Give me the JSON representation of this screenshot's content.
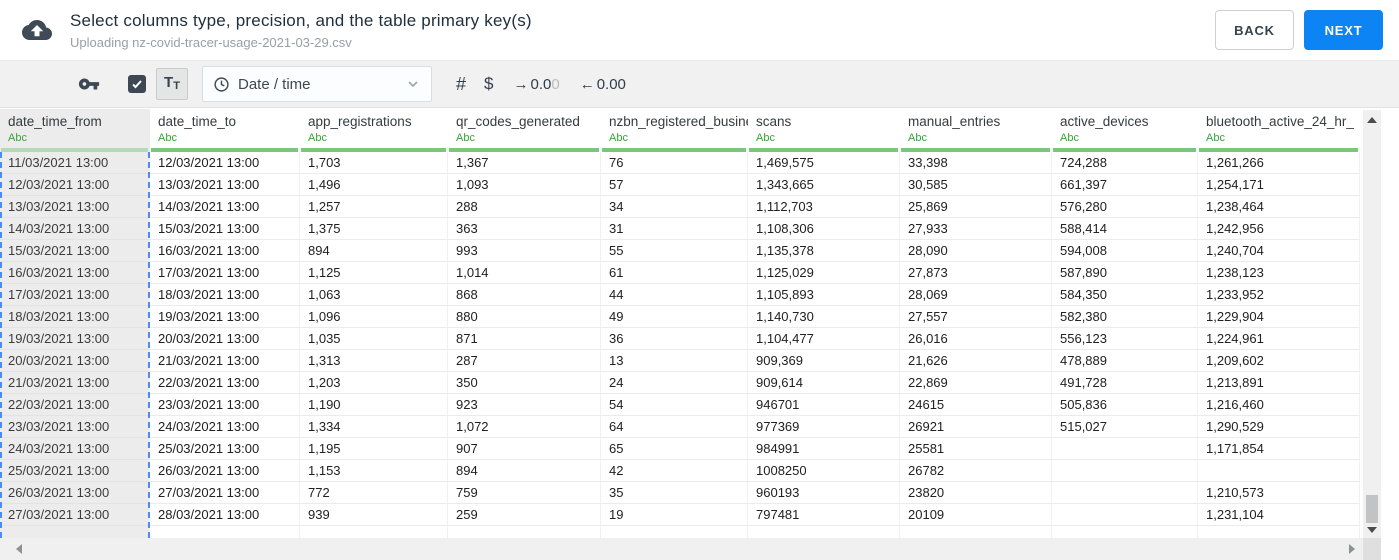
{
  "header": {
    "title": "Select columns type, precision, and the table primary key(s)",
    "subtitle": "Uploading nz-covid-tracer-usage-2021-03-29.csv",
    "back_label": "BACK",
    "next_label": "NEXT"
  },
  "toolbar": {
    "text_button": {
      "big": "T",
      "small": "T"
    },
    "type_select": {
      "value": "Date / time"
    },
    "number_label": "#",
    "currency_label": "$",
    "precision_increase": {
      "arrow": "→",
      "value": "0.0",
      "faded": "0"
    },
    "precision_decrease": {
      "arrow": "←",
      "value": "0.00"
    }
  },
  "colors": {
    "accent_blue": "#0d84f3",
    "abc_green": "#3aa23a",
    "type_bar_green": "#7cc67c",
    "selection_dashed_blue": "#4a8cf7",
    "selected_column_gray": "#ececec"
  },
  "table": {
    "type_badge": "Abc",
    "selected_column_index": 0,
    "columns": [
      "date_time_from",
      "date_time_to",
      "app_registrations",
      "qr_codes_generated",
      "nzbn_registered_busine",
      "scans",
      "manual_entries",
      "active_devices",
      "bluetooth_active_24_hr_"
    ],
    "rows": [
      [
        "11/03/2021 13:00",
        "12/03/2021 13:00",
        "1,703",
        "1,367",
        "76",
        "1,469,575",
        "33,398",
        "724,288",
        "1,261,266"
      ],
      [
        "12/03/2021 13:00",
        "13/03/2021 13:00",
        "1,496",
        "1,093",
        "57",
        "1,343,665",
        "30,585",
        "661,397",
        "1,254,171"
      ],
      [
        "13/03/2021 13:00",
        "14/03/2021 13:00",
        "1,257",
        "288",
        "34",
        "1,112,703",
        "25,869",
        "576,280",
        "1,238,464"
      ],
      [
        "14/03/2021 13:00",
        "15/03/2021 13:00",
        "1,375",
        "363",
        "31",
        "1,108,306",
        "27,933",
        "588,414",
        "1,242,956"
      ],
      [
        "15/03/2021 13:00",
        "16/03/2021 13:00",
        "894",
        "993",
        "55",
        "1,135,378",
        "28,090",
        "594,008",
        "1,240,704"
      ],
      [
        "16/03/2021 13:00",
        "17/03/2021 13:00",
        "1,125",
        "1,014",
        "61",
        "1,125,029",
        "27,873",
        "587,890",
        "1,238,123"
      ],
      [
        "17/03/2021 13:00",
        "18/03/2021 13:00",
        "1,063",
        "868",
        "44",
        "1,105,893",
        "28,069",
        "584,350",
        "1,233,952"
      ],
      [
        "18/03/2021 13:00",
        "19/03/2021 13:00",
        "1,096",
        "880",
        "49",
        "1,140,730",
        "27,557",
        "582,380",
        "1,229,904"
      ],
      [
        "19/03/2021 13:00",
        "20/03/2021 13:00",
        "1,035",
        "871",
        "36",
        "1,104,477",
        "26,016",
        "556,123",
        "1,224,961"
      ],
      [
        "20/03/2021 13:00",
        "21/03/2021 13:00",
        "1,313",
        "287",
        "13",
        "909,369",
        "21,626",
        "478,889",
        "1,209,602"
      ],
      [
        "21/03/2021 13:00",
        "22/03/2021 13:00",
        "1,203",
        "350",
        "24",
        "909,614",
        "22,869",
        "491,728",
        "1,213,891"
      ],
      [
        "22/03/2021 13:00",
        "23/03/2021 13:00",
        "1,190",
        "923",
        "54",
        "946701",
        "24615",
        "505,836",
        "1,216,460"
      ],
      [
        "23/03/2021 13:00",
        "24/03/2021 13:00",
        "1,334",
        "1,072",
        "64",
        "977369",
        "26921",
        "515,027",
        "1,290,529"
      ],
      [
        "24/03/2021 13:00",
        "25/03/2021 13:00",
        "1,195",
        "907",
        "65",
        "984991",
        "25581",
        "",
        "1,171,854"
      ],
      [
        "25/03/2021 13:00",
        "26/03/2021 13:00",
        "1,153",
        "894",
        "42",
        "1008250",
        "26782",
        "",
        ""
      ],
      [
        "26/03/2021 13:00",
        "27/03/2021 13:00",
        "772",
        "759",
        "35",
        "960193",
        "23820",
        "",
        "1,210,573"
      ],
      [
        "27/03/2021 13:00",
        "28/03/2021 13:00",
        "939",
        "259",
        "19",
        "797481",
        "20109",
        "",
        "1,231,104"
      ]
    ]
  }
}
